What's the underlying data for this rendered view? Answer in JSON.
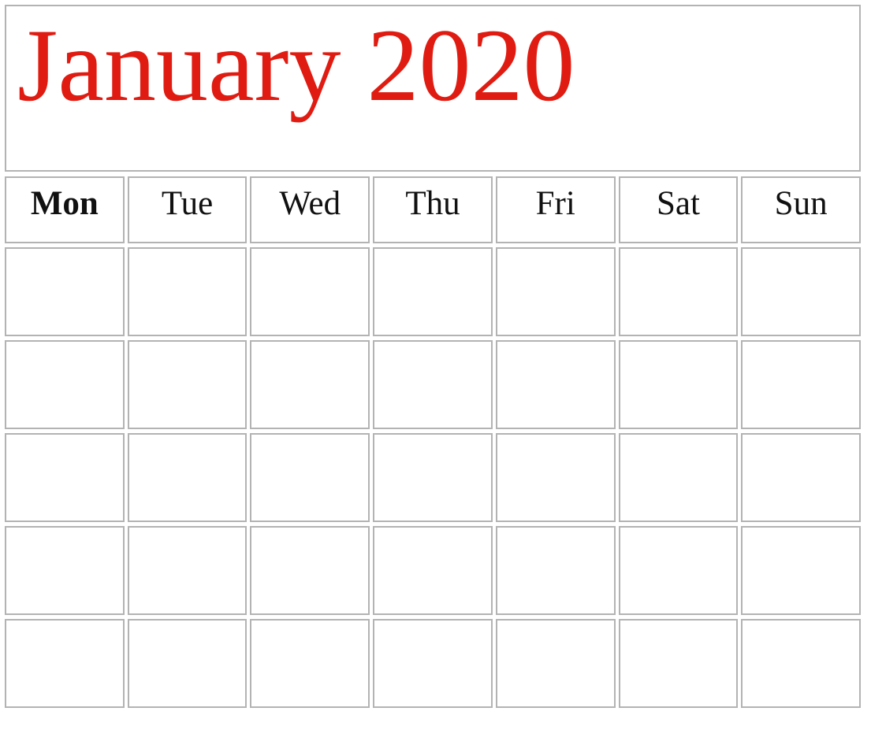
{
  "page": {
    "background_color": "#ffffff",
    "border_color": "#b3b3b3"
  },
  "title": {
    "text": "January 2020",
    "month": "January",
    "year": "2020",
    "color": "#e01c12"
  },
  "weekdays": [
    {
      "label": "Mon",
      "bold": true
    },
    {
      "label": "Tue",
      "bold": false
    },
    {
      "label": "Wed",
      "bold": false
    },
    {
      "label": "Thu",
      "bold": false
    },
    {
      "label": "Fri",
      "bold": false
    },
    {
      "label": "Sat",
      "bold": false
    },
    {
      "label": "Sun",
      "bold": false
    }
  ],
  "weeks": [
    {
      "days": [
        {
          "number": ""
        },
        {
          "number": ""
        },
        {
          "number": ""
        },
        {
          "number": ""
        },
        {
          "number": ""
        },
        {
          "number": ""
        },
        {
          "number": ""
        }
      ]
    },
    {
      "days": [
        {
          "number": ""
        },
        {
          "number": ""
        },
        {
          "number": ""
        },
        {
          "number": ""
        },
        {
          "number": ""
        },
        {
          "number": ""
        },
        {
          "number": ""
        }
      ]
    },
    {
      "days": [
        {
          "number": ""
        },
        {
          "number": ""
        },
        {
          "number": ""
        },
        {
          "number": ""
        },
        {
          "number": ""
        },
        {
          "number": ""
        },
        {
          "number": ""
        }
      ]
    },
    {
      "days": [
        {
          "number": ""
        },
        {
          "number": ""
        },
        {
          "number": ""
        },
        {
          "number": ""
        },
        {
          "number": ""
        },
        {
          "number": ""
        },
        {
          "number": ""
        }
      ]
    },
    {
      "days": [
        {
          "number": ""
        },
        {
          "number": ""
        },
        {
          "number": ""
        },
        {
          "number": ""
        },
        {
          "number": ""
        },
        {
          "number": ""
        },
        {
          "number": ""
        }
      ]
    }
  ]
}
